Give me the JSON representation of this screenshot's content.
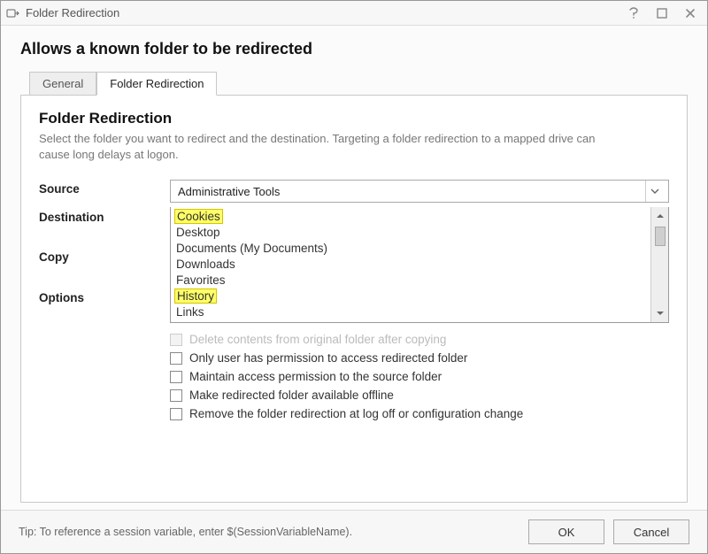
{
  "window": {
    "title": "Folder Redirection"
  },
  "heading": "Allows a known folder to be redirected",
  "tabs": {
    "general": "General",
    "fr": "Folder Redirection"
  },
  "panel": {
    "title": "Folder Redirection",
    "description": "Select the folder you want to redirect and the destination. Targeting a folder redirection to a mapped drive can cause long delays at logon."
  },
  "labels": {
    "source": "Source",
    "destination": "Destination",
    "copy": "Copy",
    "options": "Options"
  },
  "source": {
    "selected": "Administrative Tools",
    "items": {
      "cookies": "Cookies",
      "desktop": "Desktop",
      "documents": "Documents (My Documents)",
      "downloads": "Downloads",
      "favorites": "Favorites",
      "history": "History",
      "links": "Links"
    }
  },
  "checks": {
    "delete_contents": "Delete contents from original folder after copying",
    "only_user": "Only user has permission to access redirected folder",
    "maintain_access": "Maintain access permission to the source folder",
    "offline": "Make redirected folder available offline",
    "remove_on_logoff": "Remove the folder redirection at log off or configuration change"
  },
  "footer": {
    "tip": "Tip: To reference a session variable, enter $(SessionVariableName).",
    "ok": "OK",
    "cancel": "Cancel"
  }
}
